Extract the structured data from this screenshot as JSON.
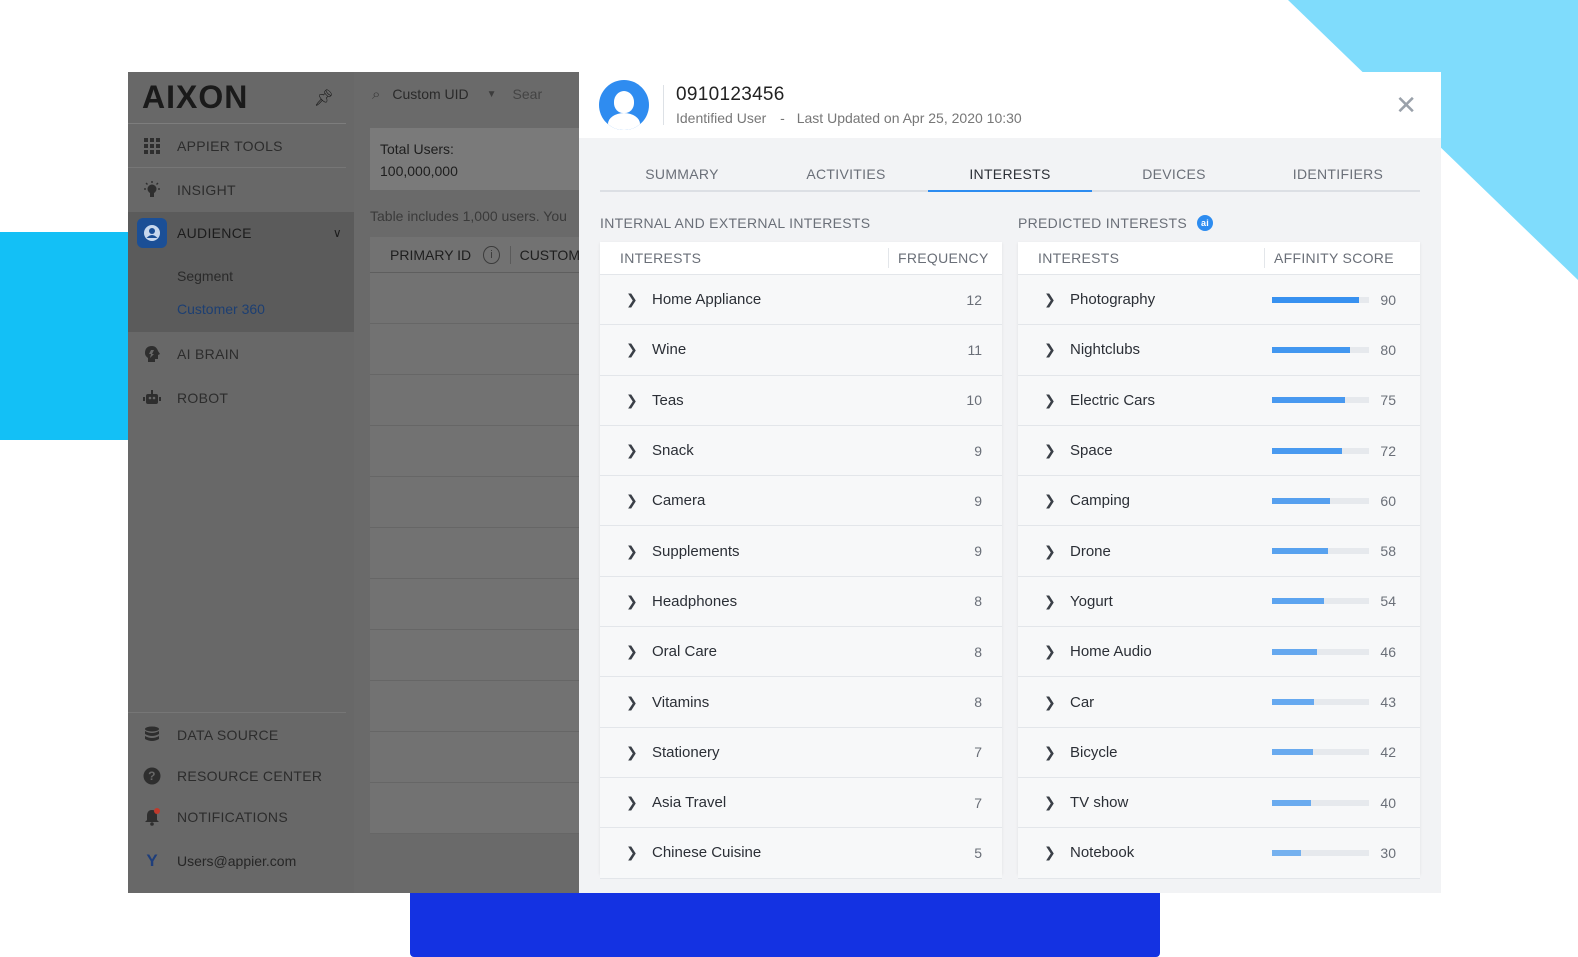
{
  "app": {
    "logo": "AIXON",
    "nav": [
      {
        "label": "APPIER TOOLS",
        "icon": "grid-icon"
      },
      {
        "label": "INSIGHT",
        "icon": "lightbulb-icon"
      },
      {
        "label": "AUDIENCE",
        "icon": "audience-icon"
      },
      {
        "label": "AI BRAIN",
        "icon": "brain-icon"
      },
      {
        "label": "ROBOT",
        "icon": "robot-icon"
      }
    ],
    "audience_sub": [
      "Segment",
      "Customer 360"
    ],
    "bottom_nav": [
      {
        "label": "DATA SOURCE",
        "icon": "database-icon"
      },
      {
        "label": "RESOURCE CENTER",
        "icon": "help-icon"
      },
      {
        "label": "NOTIFICATIONS",
        "icon": "bell-icon"
      }
    ],
    "user_initial": "Y",
    "user_email": "Users@appier.com"
  },
  "list": {
    "search_type": "Custom UID",
    "search_placeholder": "Sear",
    "total_label": "Total Users:",
    "total_value": "100,000,000",
    "table_note": "Table includes 1,000 users. You",
    "col_primary": "PRIMARY ID",
    "col_custom": "CUSTOM"
  },
  "panel": {
    "user_id": "0910123456",
    "user_type": "Identified User",
    "separator": "-",
    "last_updated": "Last Updated on Apr 25, 2020 10:30",
    "tabs": [
      "SUMMARY",
      "ACTIVITIES",
      "INTERESTS",
      "DEVICES",
      "IDENTIFIERS"
    ],
    "active_tab": "INTERESTS",
    "left_title": "INTERNAL AND EXTERNAL INTERESTS",
    "right_title": "PREDICTED INTERESTS",
    "ai_badge": "ai",
    "left_headers": {
      "interests": "INTERESTS",
      "metric": "FREQUENCY"
    },
    "right_headers": {
      "interests": "INTERESTS",
      "metric": "AFFINITY SCORE"
    },
    "internal_interests": [
      {
        "name": "Home Appliance",
        "frequency": "12"
      },
      {
        "name": "Wine",
        "frequency": "11"
      },
      {
        "name": "Teas",
        "frequency": "10"
      },
      {
        "name": "Snack",
        "frequency": "9"
      },
      {
        "name": "Camera",
        "frequency": "9"
      },
      {
        "name": "Supplements",
        "frequency": "9"
      },
      {
        "name": "Headphones",
        "frequency": "8"
      },
      {
        "name": "Oral Care",
        "frequency": "8"
      },
      {
        "name": "Vitamins",
        "frequency": "8"
      },
      {
        "name": "Stationery",
        "frequency": "7"
      },
      {
        "name": "Asia Travel",
        "frequency": "7"
      },
      {
        "name": "Chinese Cuisine",
        "frequency": "5"
      }
    ],
    "predicted_interests": [
      {
        "name": "Photography",
        "score": 90
      },
      {
        "name": "Nightclubs",
        "score": 80
      },
      {
        "name": "Electric Cars",
        "score": 75
      },
      {
        "name": "Space",
        "score": 72
      },
      {
        "name": "Camping",
        "score": 60
      },
      {
        "name": "Drone",
        "score": 58
      },
      {
        "name": "Yogurt",
        "score": 54
      },
      {
        "name": "Home Audio",
        "score": 46
      },
      {
        "name": "Car",
        "score": 43
      },
      {
        "name": "Bicycle",
        "score": 42
      },
      {
        "name": "TV show",
        "score": 40
      },
      {
        "name": "Notebook",
        "score": 30
      }
    ]
  },
  "colors": {
    "accent": "#2d8cf0",
    "deco_cyan": "#13c0f6",
    "deco_light": "#7fdcfc",
    "deco_blue": "#1432e2"
  }
}
